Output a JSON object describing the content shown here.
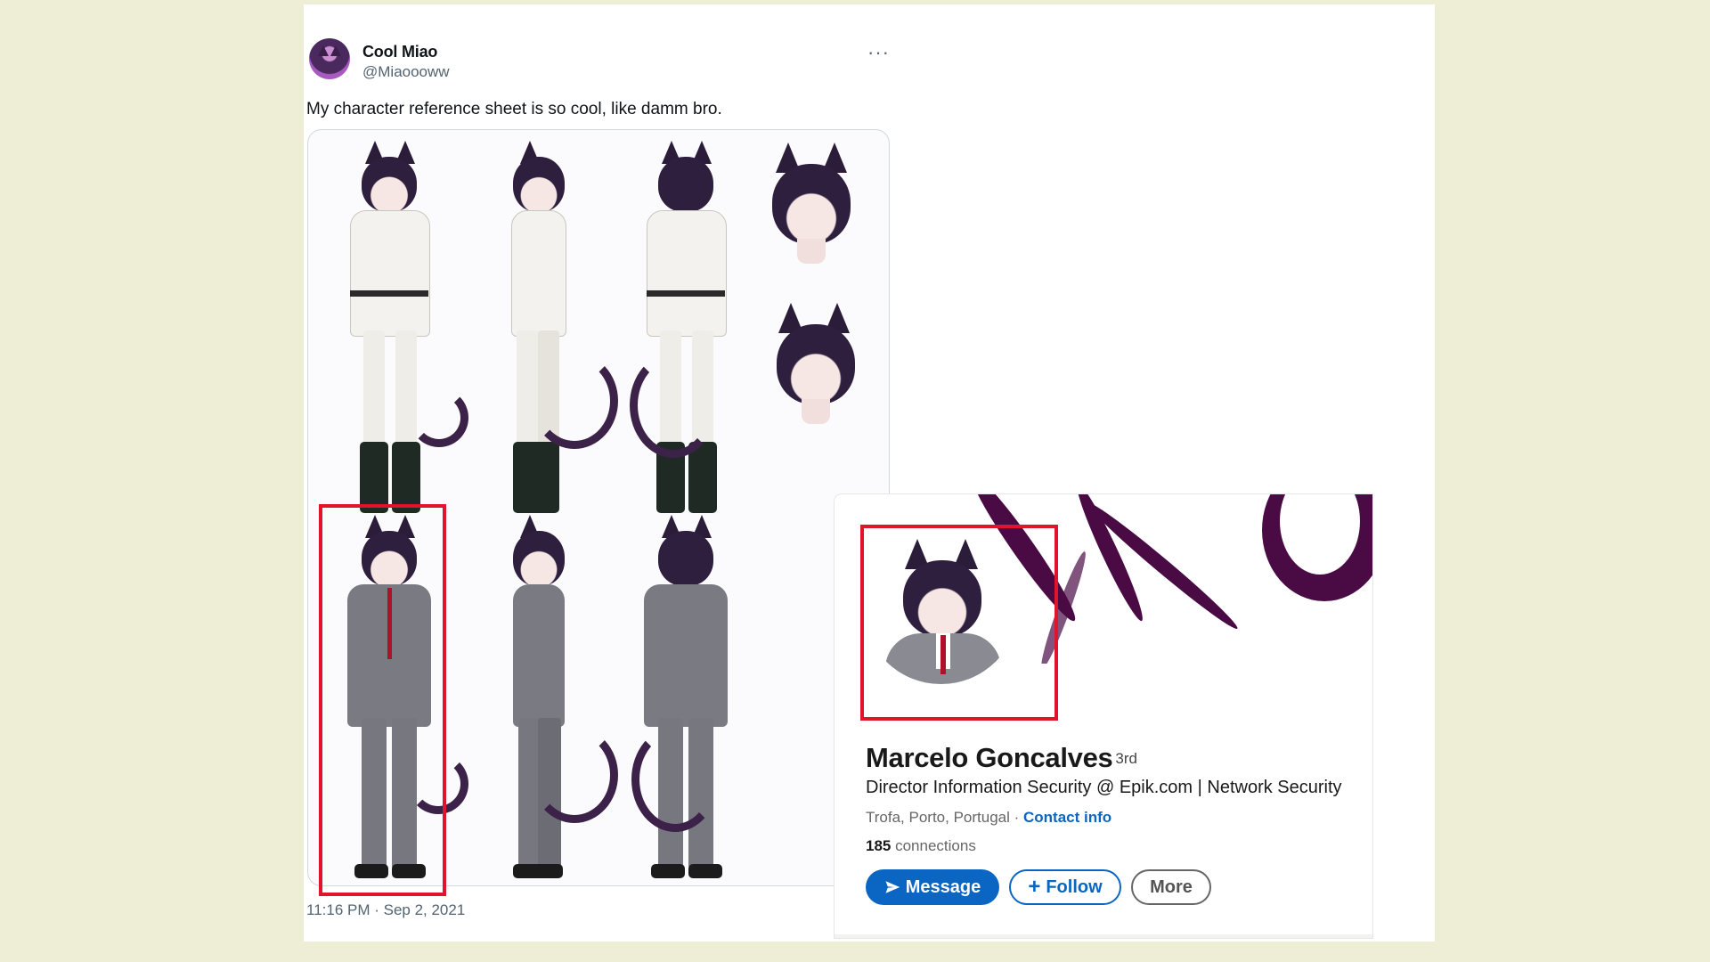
{
  "tweet": {
    "display_name": "Cool Miao",
    "handle": "@Miaoooww",
    "more_icon": "more-horizontal-icon",
    "text": "My character reference sheet is so cool, like damm bro.",
    "timestamp": "11:16 PM · Sep 2, 2021"
  },
  "linkedin": {
    "name": "Marcelo Goncalves",
    "degree": "· 3rd",
    "headline": "Director Information Security @ Epik.com | Network Security",
    "location": "Trofa, Porto, Portugal · ",
    "contact_info": "Contact info",
    "connections_count": "185",
    "connections_label": " connections",
    "buttons": {
      "message": "Message",
      "follow": "Follow",
      "more": "More"
    }
  },
  "colors": {
    "background": "#eeeed6",
    "highlight": "#e0142a",
    "linkedin_blue": "#0a66c2",
    "banner_purple": "#4a0b45"
  }
}
